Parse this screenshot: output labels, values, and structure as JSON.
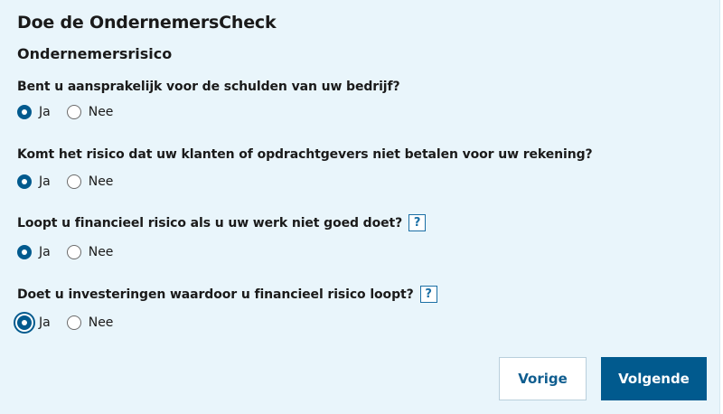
{
  "page": {
    "title": "Doe de OndernemersCheck",
    "section_title": "Ondernemersrisico"
  },
  "questions": [
    {
      "text": "Bent u aansprakelijk voor de schulden van uw bedrijf?",
      "has_help": false,
      "options": [
        "Ja",
        "Nee"
      ],
      "selected": "Ja"
    },
    {
      "text": "Komt het risico dat uw klanten of opdrachtgevers niet betalen voor uw rekening?",
      "has_help": false,
      "options": [
        "Ja",
        "Nee"
      ],
      "selected": "Ja"
    },
    {
      "text": "Loopt u financieel risico als u uw werk niet goed doet?",
      "has_help": true,
      "help_label": "?",
      "options": [
        "Ja",
        "Nee"
      ],
      "selected": "Ja"
    },
    {
      "text": "Doet u investeringen waardoor u financieel risico loopt?",
      "has_help": true,
      "help_label": "?",
      "options": [
        "Ja",
        "Nee"
      ],
      "selected": "Ja",
      "focused": true
    }
  ],
  "buttons": {
    "previous": "Vorige",
    "next": "Volgende"
  },
  "colors": {
    "panel_background": "#e9f5fb",
    "primary": "#015a8e",
    "help_icon": "#1b6fa5"
  }
}
